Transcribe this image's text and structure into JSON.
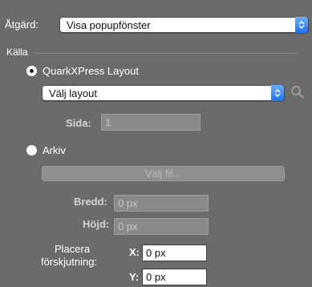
{
  "action": {
    "label": "Åtgärd:",
    "value": "Visa popupfönster"
  },
  "source": {
    "section_label": "Källa",
    "quark_option": {
      "label": "QuarkXPress Layout",
      "selected": true
    },
    "layout_select": {
      "value": "Välj layout"
    },
    "page": {
      "label": "Sida:",
      "value": "1"
    },
    "file_option": {
      "label": "Arkiv",
      "selected": false
    },
    "choose_file_button": "Välj fil..."
  },
  "size": {
    "width": {
      "label": "Bredd:",
      "value": "0 px"
    },
    "height": {
      "label": "Höjd:",
      "value": "0 px"
    }
  },
  "offset": {
    "label_line1": "Placera",
    "label_line2": "förskjutning:",
    "x": {
      "label": "X:",
      "value": "0 px"
    },
    "y": {
      "label": "Y:",
      "value": "0 px"
    }
  }
}
